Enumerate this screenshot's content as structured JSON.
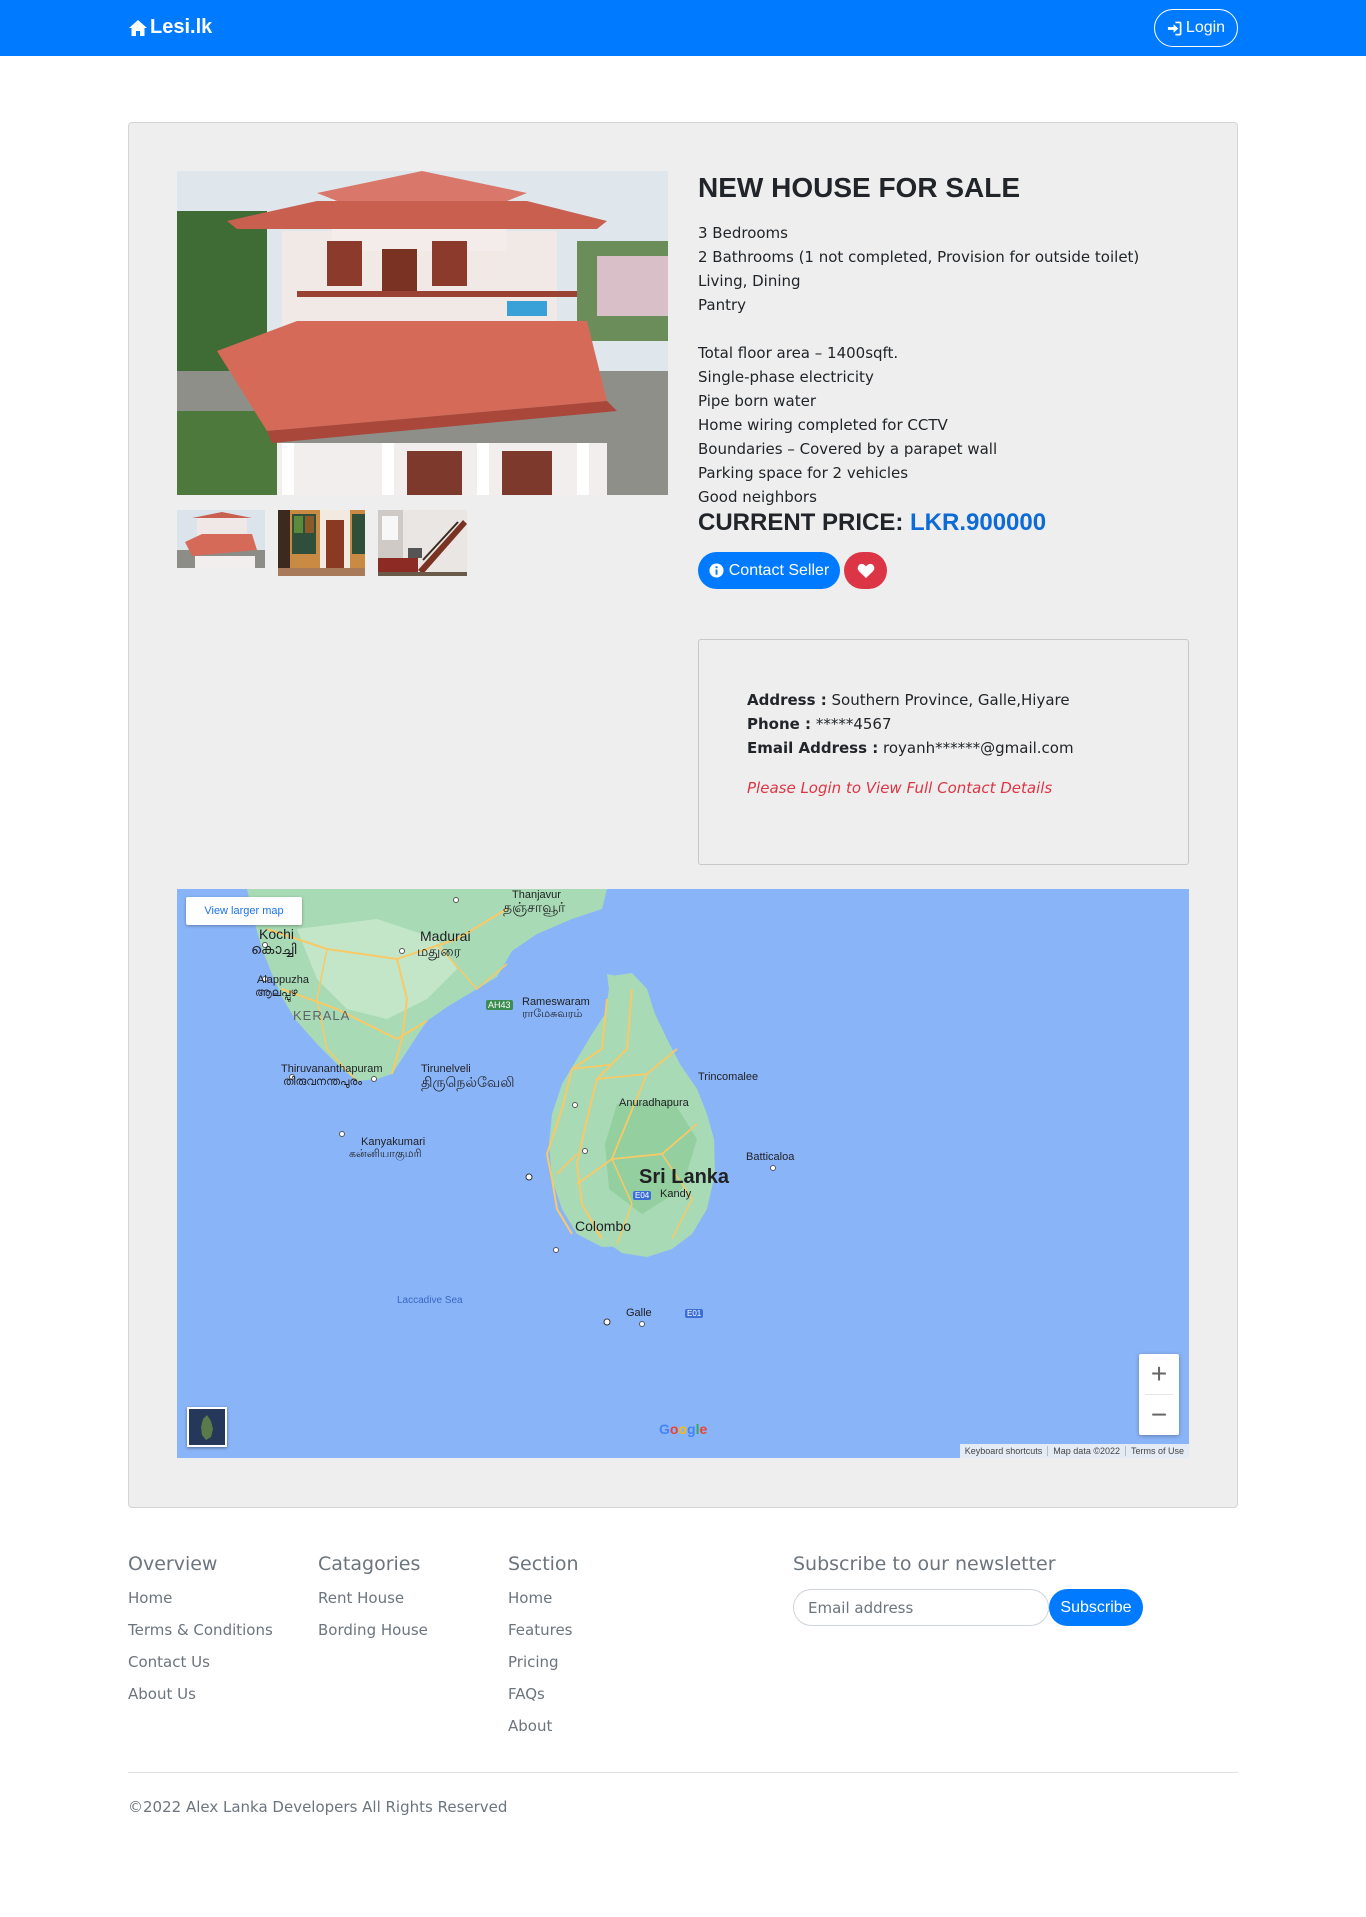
{
  "navbar": {
    "brand": "Lesi.lk",
    "login_label": "Login"
  },
  "listing": {
    "title": "NEW HOUSE FOR SALE",
    "features": [
      "3 Bedrooms",
      "2 Bathrooms (1 not completed, Provision for outside toilet)",
      "Living, Dining",
      "Pantry",
      "",
      "Total floor area – 1400sqft.",
      "Single-phase electricity",
      "Pipe born water",
      "Home wiring completed for CCTV",
      "Boundaries – Covered by a parapet wall",
      "Parking space for 2 vehicles",
      "Good neighbors"
    ],
    "price_label": "CURRENT PRICE:",
    "price_value": "LKR.900000",
    "contact_button": "Contact Seller"
  },
  "contact": {
    "address_label": "Address :",
    "address_value": "Southern Province, Galle,Hiyare",
    "phone_label": "Phone :",
    "phone_value": "*****4567",
    "email_label": "Email Address :",
    "email_value": "royanh******@gmail.com",
    "login_note": "Please Login to View Full Contact Details"
  },
  "map": {
    "view_larger": "View larger map",
    "labels": {
      "thanjavur": "Thanjavur",
      "thanjavur_ta": "தஞ்சாவூர்",
      "kochi": "Kochi",
      "kochi_ml": "കൊച്ചി",
      "madurai": "Madurai",
      "madurai_ta": "மதுரை",
      "alappuzha": "Alappuzha",
      "alappuzha_ml": "ആലപ്പുഴ",
      "kerala": "KERALA",
      "ah43": "AH43",
      "rameswaram": "Rameswaram",
      "rameswaram_ta": "ராமேசுவரம்",
      "thiruvananthapuram": "Thiruvananthapuram",
      "thiruvananthapuram_ml": "തിരുവനന്തപുരം",
      "tirunelveli": "Tirunelveli",
      "tirunelveli_ta": "திருநெல்வேலி",
      "trincomalee": "Trincomalee",
      "anuradhapura": "Anuradhapura",
      "kanyakumari": "Kanyakumari",
      "kanyakumari_ta": "கன்னியாகுமரி",
      "batticaloa": "Batticaloa",
      "sri_lanka": "Sri Lanka",
      "kandy": "Kandy",
      "e04": "E04",
      "colombo": "Colombo",
      "laccadive_sea": "Laccadive Sea",
      "galle": "Galle",
      "e01": "E01"
    },
    "google": "Google",
    "attribution": [
      "Keyboard shortcuts",
      "Map data ©2022",
      "Terms of Use"
    ],
    "zoom_in": "+",
    "zoom_out": "−",
    "colors": {
      "water": "#8ab4f8",
      "land": "#a8dab5",
      "road": "#f8c967"
    }
  },
  "footer": {
    "overview": {
      "heading": "Overview",
      "links": [
        "Home",
        "Terms & Conditions",
        "Contact Us",
        "About Us"
      ]
    },
    "categories": {
      "heading": "Catagories",
      "links": [
        "Rent House",
        "Bording House"
      ]
    },
    "section": {
      "heading": "Section",
      "links": [
        "Home",
        "Features",
        "Pricing",
        "FAQs",
        "About"
      ]
    },
    "newsletter": {
      "heading": "Subscribe to our newsletter",
      "email_placeholder": "Email address",
      "button": "Subscribe"
    },
    "copyright": "©2022 Alex Lanka Developers All Rights Reserved"
  },
  "colors": {
    "primary": "#007bff",
    "danger": "#dc3545",
    "card_bg": "#eeeeee"
  }
}
